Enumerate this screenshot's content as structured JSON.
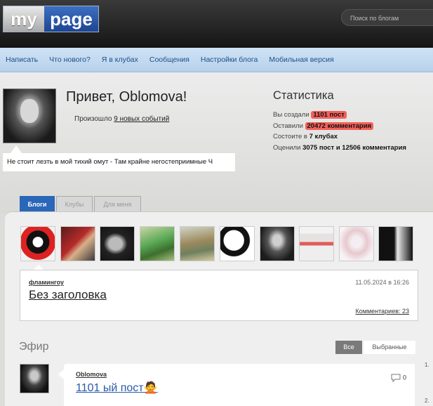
{
  "header": {
    "logo_my": "my",
    "logo_page": "page",
    "search_placeholder": "Поиск по блогам"
  },
  "nav": [
    "Написать",
    "Что нового?",
    "Я в клубах",
    "Сообщения",
    "Настройки блога",
    "Мобильная версия"
  ],
  "profile": {
    "greeting": "Привет, Oblomova!",
    "events_prefix": "Произошло ",
    "events_link": "9 новых событий",
    "status": "Не стоит лезть в мой тихий омут - Там крайне негостеприимные Ч"
  },
  "stats": {
    "title": "Статистика",
    "line1_prefix": "Вы создали ",
    "line1_value": "1101 пост",
    "line2_prefix": "Оставили ",
    "line2_value": "20472 комментария",
    "line3_prefix": "Состоите в ",
    "line3_value": "7 клубах",
    "line4_prefix": "Оценили ",
    "line4_value": "3075 пост и 12506 комментария",
    "highlight_color": "#f2605a"
  },
  "tabs": [
    "Блоги",
    "Клубы",
    "Для меня"
  ],
  "latest_post": {
    "author": "фламингоу",
    "date": "11.05.2024 в 16:26",
    "title": "Без заголовка",
    "comments": "Комментариев: 23"
  },
  "feed": {
    "title": "Эфир",
    "filter_all": "Все",
    "filter_selected": "Выбранные",
    "author": "Oblomova",
    "post_title": "1101 ый пост🙅",
    "comment_count": "0",
    "numbers": [
      "1.",
      "2."
    ]
  },
  "colors": {
    "accent_blue": "#2a67b8",
    "nav_bg": "#c6dcf2",
    "header_bg": "#1e1e1e"
  }
}
